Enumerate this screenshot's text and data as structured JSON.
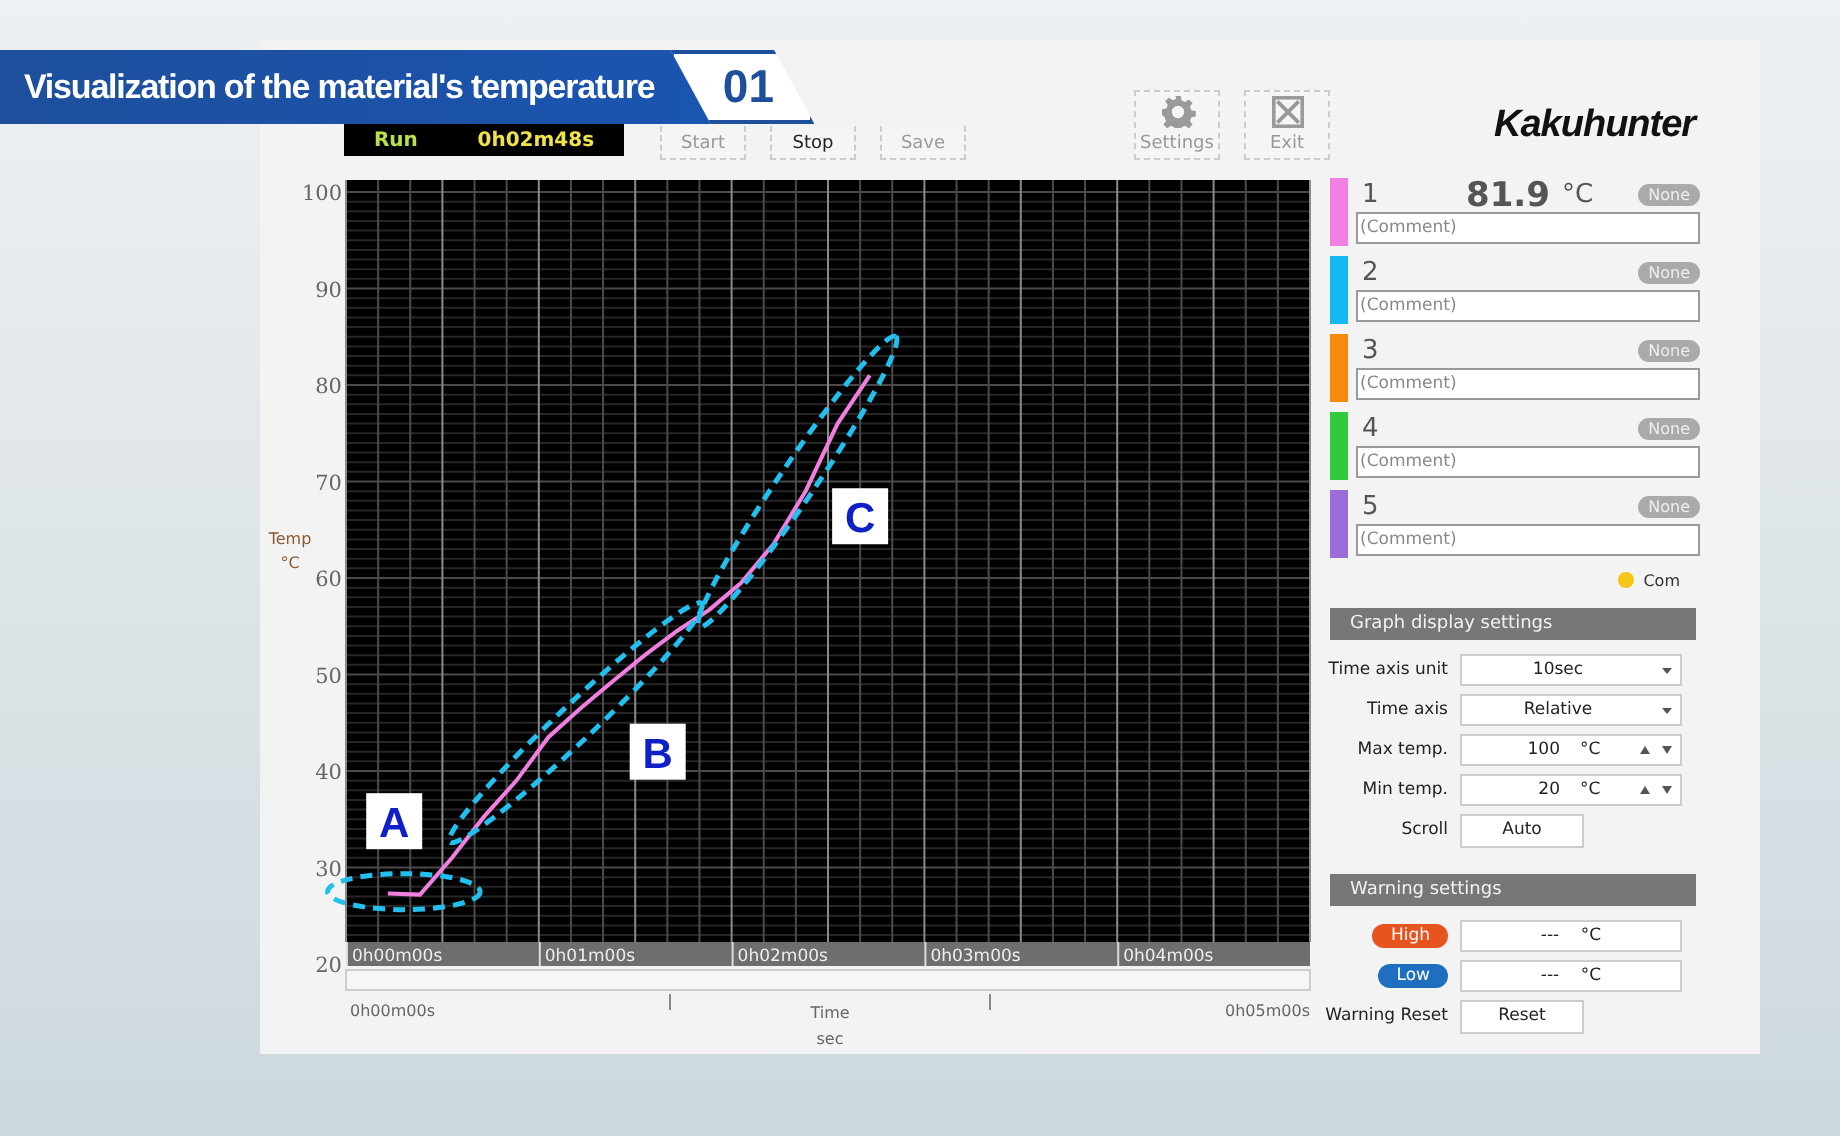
{
  "banner": {
    "title": "Visualization of the material's temperature",
    "number": "01"
  },
  "status": {
    "state": "Run",
    "elapsed": "0h02m48s"
  },
  "toolbar": [
    {
      "kind": "plain",
      "label": "Start",
      "disabled": true
    },
    {
      "kind": "plain",
      "label": "Stop",
      "disabled": false
    },
    {
      "kind": "plain",
      "label": "Save",
      "disabled": true
    },
    {
      "kind": "gear",
      "label": "Settings",
      "disabled": true
    },
    {
      "kind": "exit",
      "label": "Exit",
      "disabled": true
    }
  ],
  "logo": "Kakuhunter",
  "chart": {
    "y_unit": "°C",
    "x_unit": "sec",
    "range_start": "0h00m00s",
    "range_end": "0h05m00s",
    "chart_data": {
      "type": "line",
      "xlabel": "Time",
      "ylabel": "Temp",
      "categories": [
        "0h00m00s",
        null,
        null,
        null,
        null,
        null,
        "0h01m00s",
        null,
        null,
        null,
        null,
        null,
        "0h02m00s",
        null,
        null,
        null,
        null,
        null,
        "0h03m00s",
        null,
        null,
        null,
        null,
        null,
        "0h04m00s",
        null,
        null,
        null,
        null
      ],
      "series": [
        {
          "color": "#f07fe0",
          "values": [
            27.3,
            27.2,
            31,
            35.3,
            39,
            43.5,
            46.5,
            49.3,
            52,
            54.5,
            56.7,
            59.5,
            63.5,
            69,
            76,
            81,
            null,
            null,
            null,
            null,
            null,
            null,
            null,
            null,
            null,
            null,
            null,
            null,
            null
          ]
        }
      ],
      "ylim": [
        20,
        100
      ],
      "grid": true,
      "yticks": [
        20,
        30,
        40,
        50,
        60,
        70,
        80,
        90,
        100
      ],
      "annotations": [
        "A",
        "B",
        "C"
      ]
    }
  },
  "channels": [
    {
      "number": "1",
      "color": "#f27fe3",
      "reading": "81.9",
      "unit": "°C",
      "badge": "None",
      "placeholder": "(Comment)"
    },
    {
      "number": "2",
      "color": "#14b9f0",
      "badge": "None",
      "placeholder": "(Comment)"
    },
    {
      "number": "3",
      "color": "#f98a0e",
      "badge": "None",
      "placeholder": "(Comment)"
    },
    {
      "number": "4",
      "color": "#2fcb3c",
      "badge": "None",
      "placeholder": "(Comment)"
    },
    {
      "number": "5",
      "color": "#9a6ed8",
      "badge": "None",
      "placeholder": "(Comment)"
    }
  ],
  "legend": {
    "color": "#f5c518",
    "label": "Com"
  },
  "graph_settings": {
    "title": "Graph display settings",
    "rows": [
      {
        "kind": "select",
        "label": "Time axis unit",
        "value": "10sec"
      },
      {
        "kind": "select",
        "label": "Time axis",
        "value": "Relative"
      },
      {
        "kind": "spinner",
        "label": "Max temp.",
        "value": "100",
        "unit": "°C"
      },
      {
        "kind": "spinner",
        "label": "Min temp.",
        "value": "20",
        "unit": "°C"
      },
      {
        "kind": "button",
        "label": "Scroll",
        "value": "Auto"
      }
    ]
  },
  "warning_settings": {
    "title": "Warning settings",
    "rows": [
      {
        "kind": "badge",
        "label": "High",
        "color": "#e8541e",
        "value": "---",
        "unit": "°C"
      },
      {
        "kind": "badge",
        "label": "Low",
        "color": "#1f6fc0",
        "value": "---",
        "unit": "°C"
      },
      {
        "kind": "button",
        "label": "Warning Reset",
        "value": "Reset"
      }
    ]
  }
}
